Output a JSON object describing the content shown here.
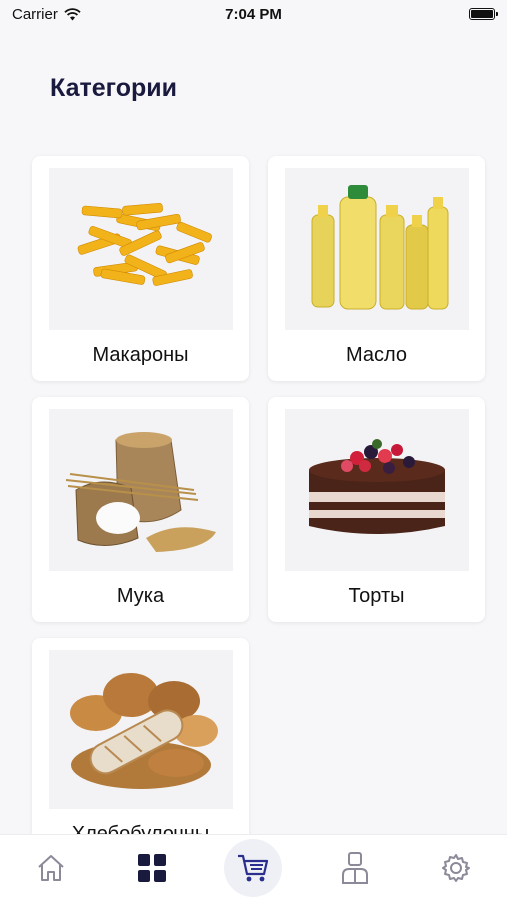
{
  "status": {
    "carrier": "Carrier",
    "time": "7:04 PM"
  },
  "page": {
    "title": "Категории"
  },
  "categories": [
    {
      "label": "Макароны"
    },
    {
      "label": "Масло"
    },
    {
      "label": "Мука"
    },
    {
      "label": "Торты"
    },
    {
      "label": "Хлебобулочны"
    }
  ],
  "tabs": [
    {
      "icon": "home-icon"
    },
    {
      "icon": "grid-icon",
      "active": true
    },
    {
      "icon": "cart-icon"
    },
    {
      "icon": "account-icon"
    },
    {
      "icon": "gear-icon"
    }
  ],
  "colors": {
    "accent": "#1a1a3e",
    "muted": "#8a8a99"
  }
}
